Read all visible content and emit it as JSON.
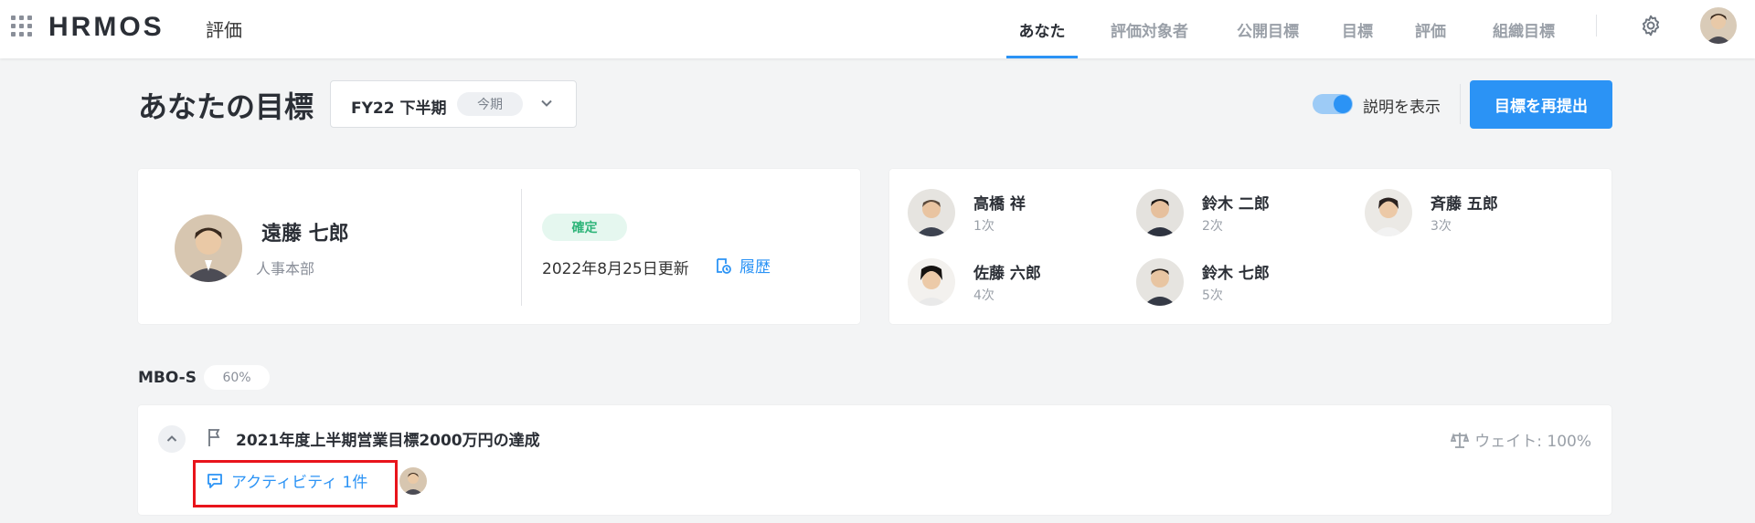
{
  "header": {
    "logo": "HRMOS",
    "product": "評価",
    "nav": [
      {
        "label": "あなた",
        "active": true
      },
      {
        "label": "評価対象者",
        "active": false
      },
      {
        "label": "公開目標",
        "active": false
      },
      {
        "label": "目標",
        "active": false
      },
      {
        "label": "評価",
        "active": false
      },
      {
        "label": "組織目標",
        "active": false
      }
    ]
  },
  "title_row": {
    "title": "あなたの目標",
    "period": "FY22 下半期",
    "period_badge": "今期",
    "toggle_label": "説明を表示",
    "toggle_on": true,
    "resubmit_label": "目標を再提出"
  },
  "user": {
    "name": "遠藤 七郎",
    "dept": "人事本部",
    "status": "確定",
    "updated": "2022年8月25日更新",
    "history_label": "履歴"
  },
  "evaluators": [
    {
      "name": "高橋 祥",
      "level": "1次"
    },
    {
      "name": "鈴木 二郎",
      "level": "2次"
    },
    {
      "name": "斉藤 五郎",
      "level": "3次"
    },
    {
      "name": "佐藤 六郎",
      "level": "4次"
    },
    {
      "name": "鈴木 七郎",
      "level": "5次"
    }
  ],
  "mbo": {
    "label": "MBO-S",
    "percent": "60%",
    "goal": {
      "title": "2021年度上半期営業目標2000万円の達成",
      "weight": "ウェイト: 100%",
      "activity": "アクティビティ 1件"
    }
  },
  "colors": {
    "accent": "#2b93f5",
    "status_green": "#2fb57a",
    "highlight_red": "#e8141b"
  }
}
